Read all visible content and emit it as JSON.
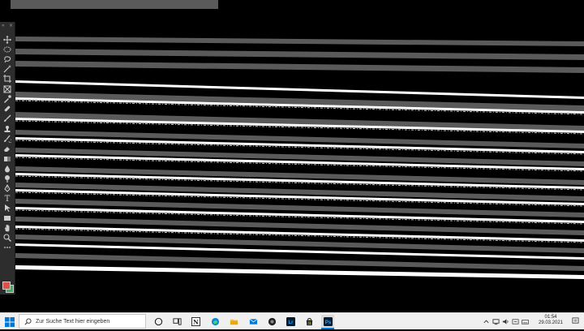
{
  "window": {
    "title": ""
  },
  "tools": [
    {
      "name": "move-tool",
      "icon": "move-icon"
    },
    {
      "name": "marquee-tool",
      "icon": "ellipse-marquee-icon"
    },
    {
      "name": "lasso-tool",
      "icon": "lasso-icon"
    },
    {
      "name": "magic-wand-tool",
      "icon": "magic-wand-icon"
    },
    {
      "name": "crop-tool",
      "icon": "crop-icon"
    },
    {
      "name": "frame-tool",
      "icon": "frame-icon"
    },
    {
      "name": "eyedropper-tool",
      "icon": "eyedropper-icon"
    },
    {
      "name": "healing-brush-tool",
      "icon": "bandage-icon"
    },
    {
      "name": "brush-tool",
      "icon": "brush-icon"
    },
    {
      "name": "clone-stamp-tool",
      "icon": "stamp-icon"
    },
    {
      "name": "history-brush-tool",
      "icon": "history-brush-icon"
    },
    {
      "name": "eraser-tool",
      "icon": "eraser-icon"
    },
    {
      "name": "gradient-tool",
      "icon": "gradient-icon"
    },
    {
      "name": "blur-tool",
      "icon": "drop-icon"
    },
    {
      "name": "dodge-tool",
      "icon": "dodge-icon"
    },
    {
      "name": "pen-tool",
      "icon": "pen-icon"
    },
    {
      "name": "type-tool",
      "icon": "type-icon"
    },
    {
      "name": "path-selection-tool",
      "icon": "arrow-icon"
    },
    {
      "name": "rectangle-tool",
      "icon": "rectangle-icon"
    },
    {
      "name": "hand-tool",
      "icon": "hand-icon"
    },
    {
      "name": "zoom-tool",
      "icon": "zoom-icon"
    },
    {
      "name": "more-tools",
      "icon": "ellipsis-icon"
    }
  ],
  "colors": {
    "foreground": "#d9534f",
    "background": "#3fae5c"
  },
  "taskbar": {
    "search_placeholder": "Zur Suche Text hier eingeben",
    "apps": [
      {
        "name": "cortana",
        "icon": "circle-icon"
      },
      {
        "name": "task-view",
        "icon": "task-view-icon"
      },
      {
        "name": "notion",
        "icon": "notion-icon"
      },
      {
        "name": "edge",
        "icon": "edge-icon"
      },
      {
        "name": "file-explorer",
        "icon": "folder-icon"
      },
      {
        "name": "mail",
        "icon": "mail-icon"
      },
      {
        "name": "app-circle",
        "icon": "camera-icon"
      },
      {
        "name": "lightroom",
        "icon": "lightroom-icon",
        "label": "Lr"
      },
      {
        "name": "store",
        "icon": "store-icon"
      },
      {
        "name": "photoshop",
        "icon": "photoshop-icon",
        "label": "Ps",
        "active": true
      }
    ],
    "clock_time": "01:54",
    "clock_date": "29.03.2021"
  },
  "accent": {
    "photoshop": "#31a8ff",
    "lightroom": "#31a8ff",
    "edge": "#0c8ad6",
    "windows": "#0078d7"
  }
}
